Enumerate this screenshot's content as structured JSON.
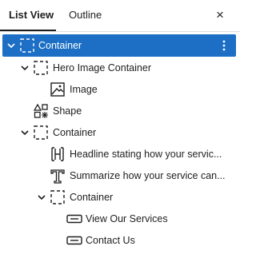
{
  "tabs": {
    "list_view": "List View",
    "outline": "Outline",
    "close": "×"
  },
  "tree": [
    {
      "label": "Container",
      "icon": "container-icon",
      "level": 0,
      "expanded": true,
      "selected": true,
      "options": true
    },
    {
      "label": "Hero Image Container",
      "icon": "container-icon",
      "level": 1,
      "expanded": true
    },
    {
      "label": "Image",
      "icon": "image-icon",
      "level": 2
    },
    {
      "label": "Shape",
      "icon": "shape-icon",
      "level": 1
    },
    {
      "label": "Container",
      "icon": "container-icon",
      "level": 1,
      "expanded": true
    },
    {
      "label": "Headline stating how your servic...",
      "icon": "headline-icon",
      "level": 2
    },
    {
      "label": "Summarize how your service can...",
      "icon": "text-icon",
      "level": 2
    },
    {
      "label": "Container",
      "icon": "container-icon",
      "level": 2,
      "expanded": true
    },
    {
      "label": "View Our Services",
      "icon": "button-icon",
      "level": 3
    },
    {
      "label": "Contact Us",
      "icon": "button-icon",
      "level": 3
    }
  ],
  "colors": {
    "selected_bg": "#1c6fc5",
    "text": "#1e1e1e"
  }
}
